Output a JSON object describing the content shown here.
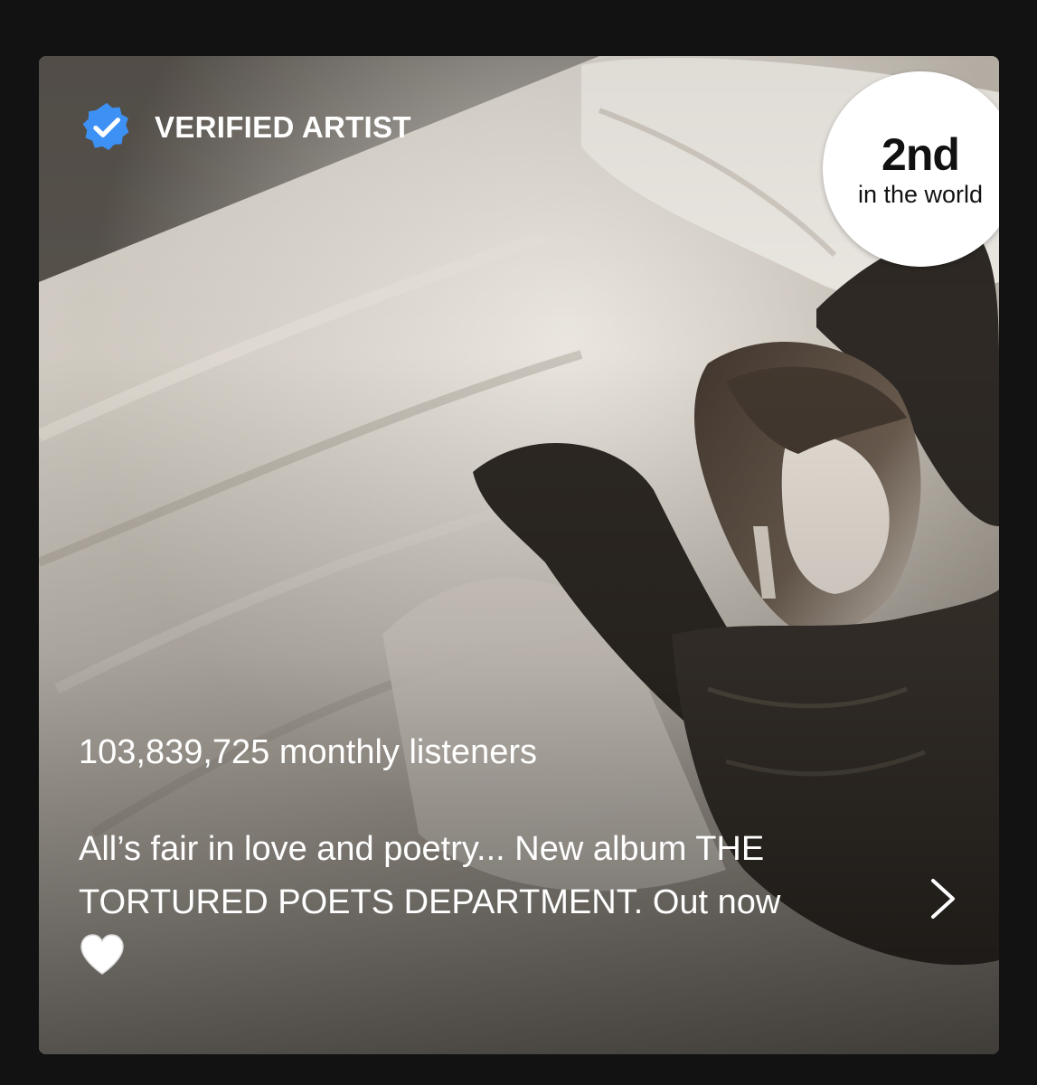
{
  "artist": {
    "verified_label": "VERIFIED ARTIST",
    "rank": {
      "value": "2nd",
      "subtitle": "in the world"
    },
    "monthly_listeners": "103,839,725 monthly listeners",
    "bio_line_1": "All’s fair in love and poetry... New album THE",
    "bio_line_2": "TORTURED POETS DEPARTMENT. Out now"
  },
  "icons": {
    "verified": "verified-badge-icon",
    "heart": "white-heart-emoji",
    "chevron": "chevron-right-icon"
  },
  "colors": {
    "page_background": "#121212",
    "verified_badge": "#3d91f4",
    "text": "#ffffff",
    "rank_circle": "#ffffff"
  }
}
